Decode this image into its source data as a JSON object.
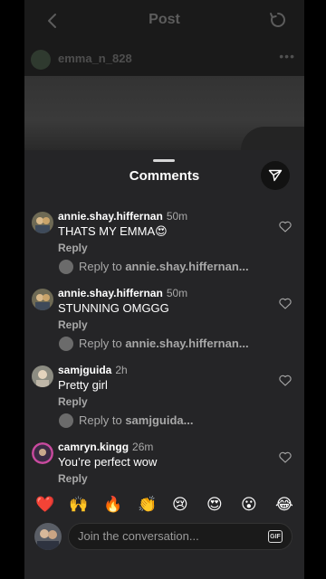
{
  "header": {
    "title": "Post",
    "back_icon": "chevron-left-icon",
    "refresh_icon": "refresh-icon"
  },
  "post": {
    "username": "emma_n_828",
    "more_icon": "more-horizontal-icon"
  },
  "sheet": {
    "title": "Comments",
    "share_icon": "send-icon"
  },
  "comments": [
    {
      "author": "annie.shay.hiffernan",
      "time": "50m",
      "text": "THATS MY EMMA😍",
      "reply_label": "Reply",
      "reply_to_label": "Reply to",
      "reply_to_user": "annie.shay.hiffernan..."
    },
    {
      "author": "annie.shay.hiffernan",
      "time": "50m",
      "text": "STUNNING OMGGG",
      "reply_label": "Reply",
      "reply_to_label": "Reply to",
      "reply_to_user": "annie.shay.hiffernan..."
    },
    {
      "author": "samjguida",
      "time": "2h",
      "text": "Pretty girl",
      "reply_label": "Reply",
      "reply_to_label": "Reply to",
      "reply_to_user": "samjguida..."
    },
    {
      "author": "camryn.kingg",
      "time": "26m",
      "text": "You’re perfect wow",
      "reply_label": "Reply"
    }
  ],
  "emojis": [
    "❤️",
    "🙌",
    "🔥",
    "👏",
    "😢",
    "😍",
    "😮",
    "😂"
  ],
  "input": {
    "placeholder": "Join the conversation...",
    "gif_label": "GIF"
  },
  "colors": {
    "sheet_bg": "#252527",
    "muted_text": "#a8a8a8",
    "heart_red": "#ff3040"
  }
}
